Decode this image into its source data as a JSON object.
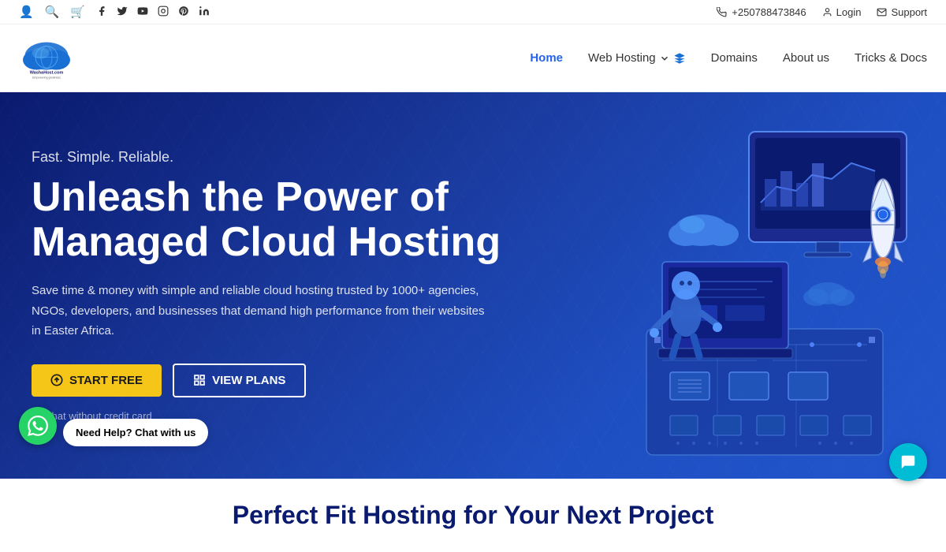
{
  "topbar": {
    "phone": "+250788473846",
    "login_label": "Login",
    "support_label": "Support",
    "icons": {
      "account": "👤",
      "search": "🔍",
      "cart": "🛒"
    },
    "social": [
      "f",
      "𝕏",
      "▶",
      "📷",
      "𝐏",
      "in"
    ]
  },
  "nav": {
    "logo_alt": "WashaHost.com",
    "tagline": "Empowering greatness",
    "links": [
      {
        "label": "Home",
        "active": true,
        "has_dropdown": false
      },
      {
        "label": "Web Hosting",
        "active": false,
        "has_dropdown": true
      },
      {
        "label": "Domains",
        "active": false,
        "has_dropdown": false
      },
      {
        "label": "About us",
        "active": false,
        "has_dropdown": false
      },
      {
        "label": "Tricks & Docs",
        "active": false,
        "has_dropdown": false
      }
    ]
  },
  "hero": {
    "tagline": "Fast. Simple. Reliable.",
    "title_line1": "Unleash the Power of",
    "title_line2": "Managed Cloud Hosting",
    "description": "Save time & money with simple and reliable cloud hosting trusted by 1000+ agencies, NGOs, developers, and businesses that demand high performance from their websites in Easter Africa.",
    "btn_start": "START FREE",
    "btn_view": "VIEW PLANS",
    "note": "Try that without credit card"
  },
  "bottom_section": {
    "title": "Perfect Fit Hosting for Your Next Project"
  },
  "chat": {
    "whatsapp_label": "Need Help?",
    "whatsapp_action": "Chat with us"
  }
}
